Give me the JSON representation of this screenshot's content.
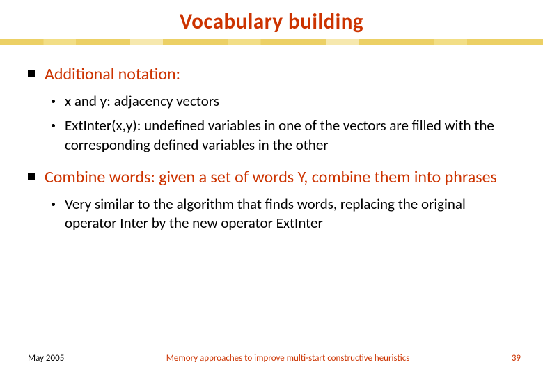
{
  "title": "Vocabulary building",
  "bullets": {
    "b1": {
      "heading": "Additional notation:",
      "sub1": "x and y: adjacency vectors",
      "sub2": "ExtInter(x,y): undefined variables in one of the vectors are filled with the corresponding defined variables in the other"
    },
    "b2": {
      "heading": "Combine words: given a set of words Y, combine them into phrases",
      "sub1": "Very similar to the algorithm that finds words, replacing the original operator Inter by the new operator ExtInter"
    }
  },
  "footer": {
    "date": "May 2005",
    "title": "Memory approaches to improve multi-start constructive heuristics",
    "page": "39"
  }
}
